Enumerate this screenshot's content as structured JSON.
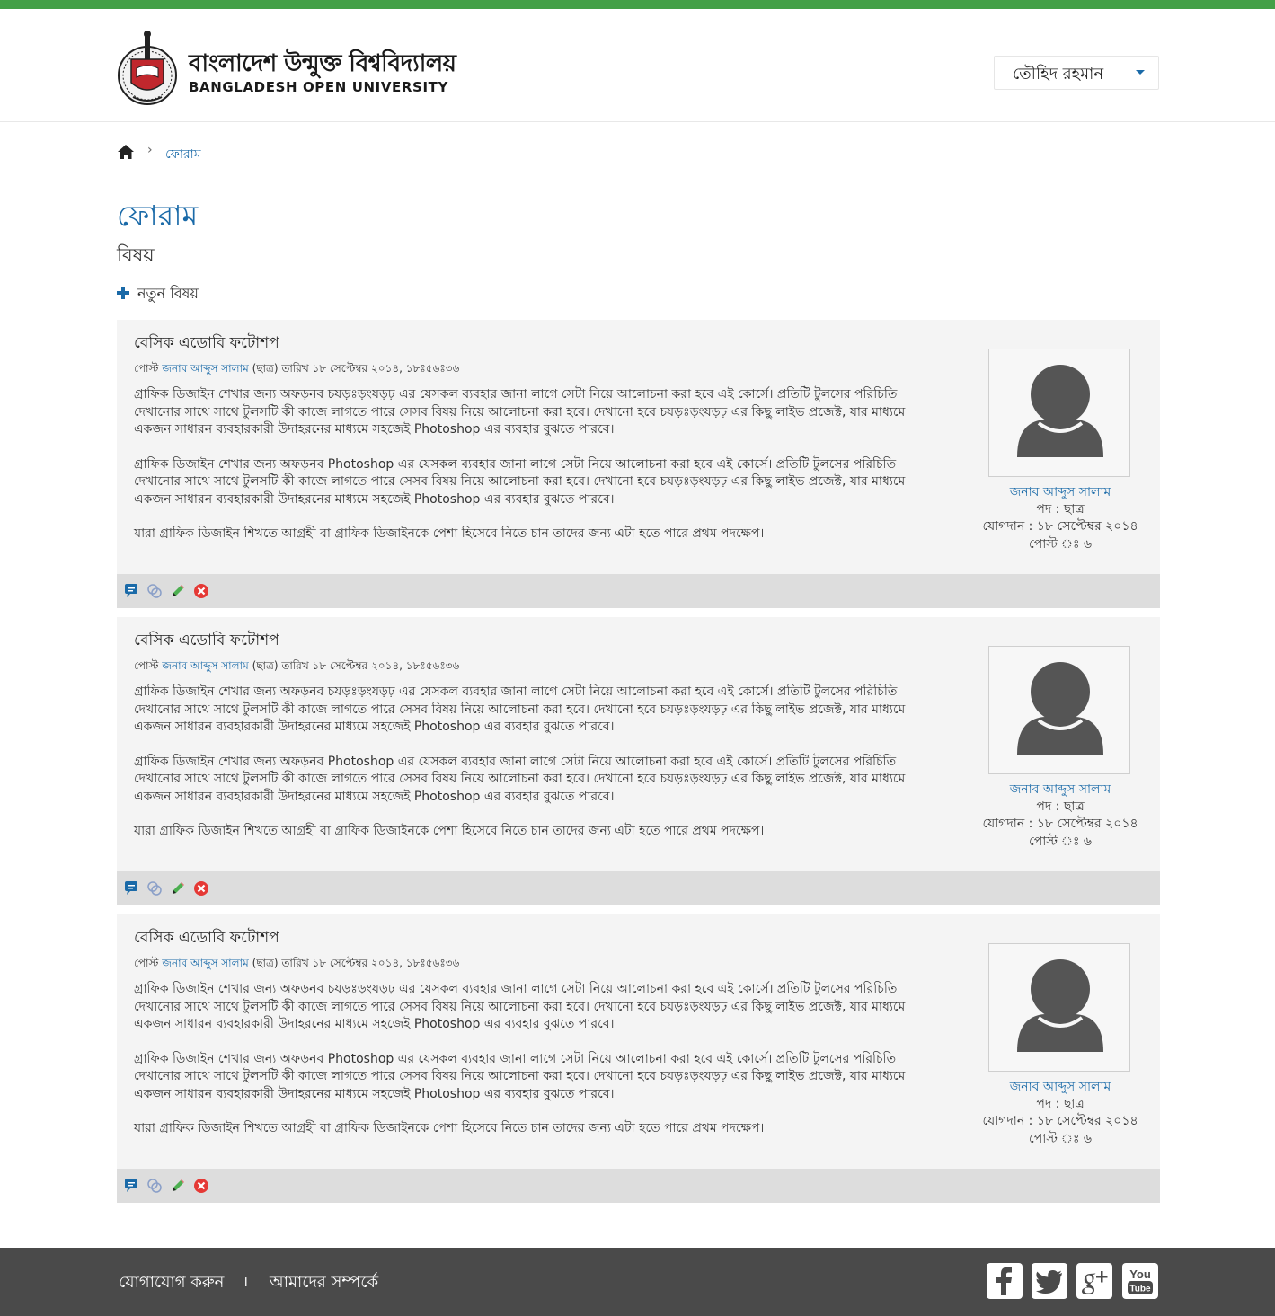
{
  "colors": {
    "accent_green": "#43a047",
    "link_blue": "#1a6aa8",
    "footer_bg": "#4a4a4a"
  },
  "header": {
    "logo_bn": "বাংলাদেশ উন্মুক্ত বিশ্ববিদ্যালয়",
    "logo_en": "BANGLADESH OPEN UNIVERSITY",
    "user_name": "তৌহিদ রহমান"
  },
  "breadcrumb": {
    "current": "ফোরাম",
    "separator": "›"
  },
  "page": {
    "title": "ফোরাম",
    "subtitle": "বিষয়",
    "new_topic_label": "নতুন বিষয়"
  },
  "posts": [
    {
      "title": "বেসিক এডোবি ফটোশপ",
      "meta_prefix": "পোস্ট",
      "author": "জনাব আব্দুস সালাম",
      "meta_suffix": "(ছাত্র) তারিখ ১৮ সেপ্টেম্বর ২০১৪, ১৮ঃ৫৬ঃ৩৬",
      "paragraphs": [
        "গ্রাফিক ডিজাইন শেখার জন্য অফড়নব চযড়ঃড়ংযড়ঢ় এর যেসকল ব্যবহার জানা লাগে সেটা নিয়ে আলোচনা করা হবে এই কোর্সে। প্রতিটি টুলসের পরিচিতি দেখানোর সাথে সাথে টুলসটি কী কাজে লাগতে পারে সেসব বিষয় নিয়ে আলোচনা করা হবে। দেখানো হবে চযড়ঃড়ংযড়ঢ় এর কিছু লাইভ প্রজেক্ট, যার মাধ্যমে একজন সাধারন ব্যবহারকারী উদাহরনের মাধ্যমে সহজেই Photoshop এর ব্যবহার বুঝতে পারবে।",
        "গ্রাফিক ডিজাইন শেখার জন্য অফড়নব Photoshop এর যেসকল ব্যবহার জানা লাগে সেটা নিয়ে আলোচনা করা হবে এই কোর্সে। প্রতিটি টুলসের পরিচিতি দেখানোর সাথে সাথে টুলসটি কী কাজে লাগতে পারে সেসব বিষয় নিয়ে আলোচনা করা হবে। দেখানো হবে চযড়ঃড়ংযড়ঢ় এর কিছু লাইভ প্রজেক্ট, যার মাধ্যমে একজন সাধারন ব্যবহারকারী উদাহরনের মাধ্যমে সহজেই Photoshop এর ব্যবহার বুঝতে পারবে।",
        "যারা গ্রাফিক ডিজাইন শিখতে আগ্রহী বা গ্রাফিক ডিজাইনকে পেশা হিসেবে নিতে চান তাদের জন্য এটা হতে পারে প্রথম পদক্ষেপ।"
      ],
      "author_role": "পদ : ছাত্র",
      "author_joined": "যোগদান : ১৮ সেপ্টেম্বর ২০১৪",
      "author_posts": "পোস্ট ঃ ৬"
    },
    {
      "title": "বেসিক এডোবি ফটোশপ",
      "meta_prefix": "পোস্ট",
      "author": "জনাব আব্দুস সালাম",
      "meta_suffix": "(ছাত্র) তারিখ ১৮ সেপ্টেম্বর ২০১৪, ১৮ঃ৫৬ঃ৩৬",
      "paragraphs": [
        "গ্রাফিক ডিজাইন শেখার জন্য অফড়নব চযড়ঃড়ংযড়ঢ় এর যেসকল ব্যবহার জানা লাগে সেটা নিয়ে আলোচনা করা হবে এই কোর্সে। প্রতিটি টুলসের পরিচিতি দেখানোর সাথে সাথে টুলসটি কী কাজে লাগতে পারে সেসব বিষয় নিয়ে আলোচনা করা হবে। দেখানো হবে চযড়ঃড়ংযড়ঢ় এর কিছু লাইভ প্রজেক্ট, যার মাধ্যমে একজন সাধারন ব্যবহারকারী উদাহরনের মাধ্যমে সহজেই Photoshop এর ব্যবহার বুঝতে পারবে।",
        "গ্রাফিক ডিজাইন শেখার জন্য অফড়নব Photoshop এর যেসকল ব্যবহার জানা লাগে সেটা নিয়ে আলোচনা করা হবে এই কোর্সে। প্রতিটি টুলসের পরিচিতি দেখানোর সাথে সাথে টুলসটি কী কাজে লাগতে পারে সেসব বিষয় নিয়ে আলোচনা করা হবে। দেখানো হবে চযড়ঃড়ংযড়ঢ় এর কিছু লাইভ প্রজেক্ট, যার মাধ্যমে একজন সাধারন ব্যবহারকারী উদাহরনের মাধ্যমে সহজেই Photoshop এর ব্যবহার বুঝতে পারবে।",
        "যারা গ্রাফিক ডিজাইন শিখতে আগ্রহী বা গ্রাফিক ডিজাইনকে পেশা হিসেবে নিতে চান তাদের জন্য এটা হতে পারে প্রথম পদক্ষেপ।"
      ],
      "author_role": "পদ : ছাত্র",
      "author_joined": "যোগদান : ১৮ সেপ্টেম্বর ২০১৪",
      "author_posts": "পোস্ট ঃ ৬"
    },
    {
      "title": "বেসিক এডোবি ফটোশপ",
      "meta_prefix": "পোস্ট",
      "author": "জনাব আব্দুস সালাম",
      "meta_suffix": "(ছাত্র) তারিখ ১৮ সেপ্টেম্বর ২০১৪, ১৮ঃ৫৬ঃ৩৬",
      "paragraphs": [
        "গ্রাফিক ডিজাইন শেখার জন্য অফড়নব চযড়ঃড়ংযড়ঢ় এর যেসকল ব্যবহার জানা লাগে সেটা নিয়ে আলোচনা করা হবে এই কোর্সে। প্রতিটি টুলসের পরিচিতি দেখানোর সাথে সাথে টুলসটি কী কাজে লাগতে পারে সেসব বিষয় নিয়ে আলোচনা করা হবে। দেখানো হবে চযড়ঃড়ংযড়ঢ় এর কিছু লাইভ প্রজেক্ট, যার মাধ্যমে একজন সাধারন ব্যবহারকারী উদাহরনের মাধ্যমে সহজেই Photoshop এর ব্যবহার বুঝতে পারবে।",
        "গ্রাফিক ডিজাইন শেখার জন্য অফড়নব Photoshop এর যেসকল ব্যবহার জানা লাগে সেটা নিয়ে আলোচনা করা হবে এই কোর্সে। প্রতিটি টুলসের পরিচিতি দেখানোর সাথে সাথে টুলসটি কী কাজে লাগতে পারে সেসব বিষয় নিয়ে আলোচনা করা হবে। দেখানো হবে চযড়ঃড়ংযড়ঢ় এর কিছু লাইভ প্রজেক্ট, যার মাধ্যমে একজন সাধারন ব্যবহারকারী উদাহরনের মাধ্যমে সহজেই Photoshop এর ব্যবহার বুঝতে পারবে।",
        "যারা গ্রাফিক ডিজাইন শিখতে আগ্রহী বা গ্রাফিক ডিজাইনকে পেশা হিসেবে নিতে চান তাদের জন্য এটা হতে পারে প্রথম পদক্ষেপ।"
      ],
      "author_role": "পদ : ছাত্র",
      "author_joined": "যোগদান : ১৮ সেপ্টেম্বর ২০১৪",
      "author_posts": "পোস্ট ঃ ৬"
    }
  ],
  "post_action_icons": [
    "reply-icon",
    "quote-icon",
    "edit-icon",
    "delete-icon"
  ],
  "footer": {
    "contact_label": "যোগাযোগ করুন",
    "separator": "।",
    "about_label": "আমাদের সম্পর্কে",
    "social_icons": [
      "facebook-icon",
      "twitter-icon",
      "google-plus-icon",
      "youtube-icon"
    ],
    "youtube_text_top": "You",
    "youtube_text_bottom": "Tube"
  }
}
